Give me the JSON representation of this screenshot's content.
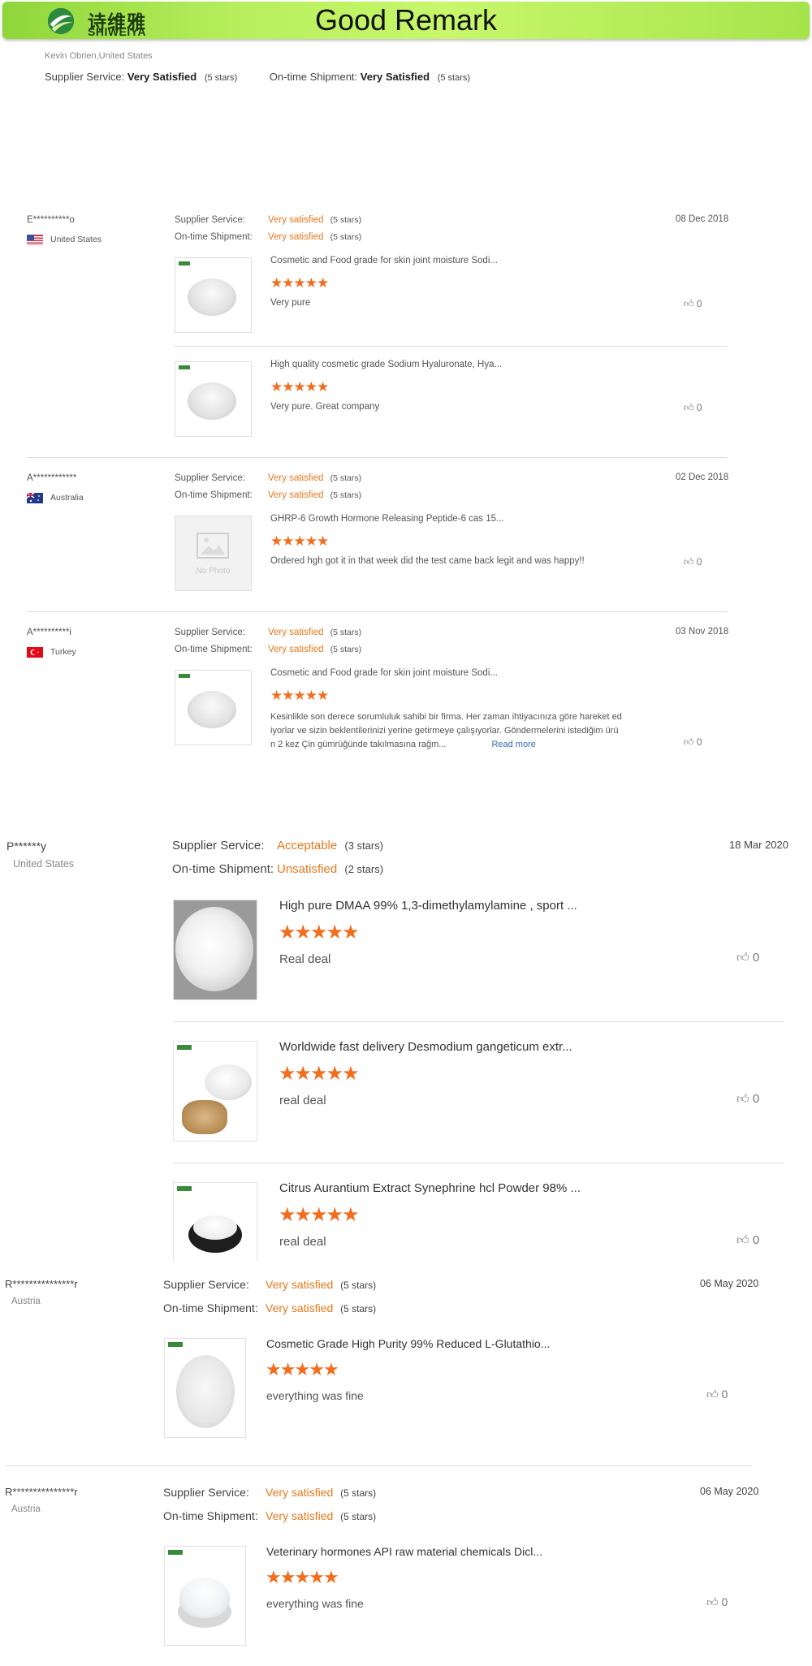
{
  "header": {
    "logo_cn": "诗维雅",
    "logo_en": "SHIWEIYA",
    "title": "Good Remark"
  },
  "top_review": {
    "reviewer": "Kevin Obrien,United States",
    "supplier_label": "Supplier Service:",
    "supplier_value": "Very Satisfied",
    "supplier_stars": "(5 stars)",
    "shipment_label": "On-time Shipment:",
    "shipment_value": "Very Satisfied",
    "shipment_stars": "(5 stars)"
  },
  "reviews_a": [
    {
      "name": "E**********o",
      "country": "United States",
      "date": "08 Dec 2018",
      "supplier_label": "Supplier Service:",
      "supplier_value": "Very satisfied",
      "supplier_stars": "(5 stars)",
      "shipment_label": "On-time Shipment:",
      "shipment_value": "Very satisfied",
      "shipment_stars": "(5 stars)",
      "items": [
        {
          "title": "Cosmetic and Food grade for skin joint moisture Sodi...",
          "comment": "Very pure",
          "likes": "0"
        },
        {
          "title": "High quality cosmetic grade Sodium Hyaluronate, Hya...",
          "comment": "Very pure. Great company",
          "likes": "0"
        }
      ]
    },
    {
      "name": "A************",
      "country": "Australia",
      "date": "02 Dec 2018",
      "supplier_label": "Supplier Service:",
      "supplier_value": "Very satisfied",
      "supplier_stars": "(5 stars)",
      "shipment_label": "On-time Shipment:",
      "shipment_value": "Very satisfied",
      "shipment_stars": "(5 stars)",
      "items": [
        {
          "title": "GHRP-6 Growth Hormone Releasing Peptide-6 cas 15...",
          "comment": "Ordered hgh got it in that week did the test came back legit and was happy!!",
          "likes": "0",
          "no_photo": "No Photo"
        }
      ]
    },
    {
      "name": "A**********i",
      "country": "Turkey",
      "date": "03 Nov 2018",
      "supplier_label": "Supplier Service:",
      "supplier_value": "Very satisfied",
      "supplier_stars": "(5 stars)",
      "shipment_label": "On-time Shipment:",
      "shipment_value": "Very satisfied",
      "shipment_stars": "(5 stars)",
      "items": [
        {
          "title": "Cosmetic and Food grade for skin joint moisture Sodi...",
          "comment_l1": "Kesinlikle son derece sorumluluk sahibi bir firma. Her zaman ihtiyacınıza göre hareket ed",
          "comment_l2": "iyorlar ve sizin beklentilerinizi yerine getirmeye çalışıyorlar. Göndermelerini istediğim ürü",
          "comment_l3": "n 2 kez Çin gümrüğünde takılmasına rağm...",
          "read_more": "Read more",
          "likes": "0"
        }
      ]
    }
  ],
  "review_b": {
    "name": "P******y",
    "country": "United States",
    "date": "18 Mar 2020",
    "supplier_label": "Supplier Service:",
    "supplier_value": "Acceptable",
    "supplier_stars": "(3 stars)",
    "shipment_label": "On-time Shipment:",
    "shipment_value": "Unsatisfied",
    "shipment_stars": "(2 stars)",
    "items": [
      {
        "title": "High pure DMAA 99% 1,3-dimethylamylamine , sport ...",
        "comment": "Real deal",
        "likes": "0"
      },
      {
        "title": "Worldwide fast delivery Desmodium gangeticum extr...",
        "comment": "real deal",
        "likes": "0"
      },
      {
        "title": "Citrus Aurantium Extract Synephrine hcl Powder 98% ...",
        "comment": "real deal",
        "likes": "0"
      }
    ]
  },
  "reviews_c": [
    {
      "name": "R***************r",
      "country": "Austria",
      "date": "06 May 2020",
      "supplier_label": "Supplier Service:",
      "supplier_value": "Very satisfied",
      "supplier_stars": "(5 stars)",
      "shipment_label": "On-time Shipment:",
      "shipment_value": "Very satisfied",
      "shipment_stars": "(5 stars)",
      "item": {
        "title": "Cosmetic Grade High Purity 99% Reduced L-Glutathio...",
        "comment": "everything was fine",
        "likes": "0"
      }
    },
    {
      "name": "R***************r",
      "country": "Austria",
      "date": "06 May 2020",
      "supplier_label": "Supplier Service:",
      "supplier_value": "Very satisfied",
      "supplier_stars": "(5 stars)",
      "shipment_label": "On-time Shipment:",
      "shipment_value": "Very satisfied",
      "shipment_stars": "(5 stars)",
      "item": {
        "title": "Veterinary hormones API raw material chemicals Dicl...",
        "comment": "everything was fine",
        "likes": "0"
      }
    }
  ],
  "colors": {
    "accent": "#f26d1d",
    "header_green": "#b8ef5e",
    "link_blue": "#2a6ebb"
  },
  "icons": [
    "logo-icon",
    "star-icon",
    "thumbs-up-icon",
    "flag-us-icon",
    "flag-au-icon",
    "flag-tr-icon",
    "no-photo-icon"
  ]
}
